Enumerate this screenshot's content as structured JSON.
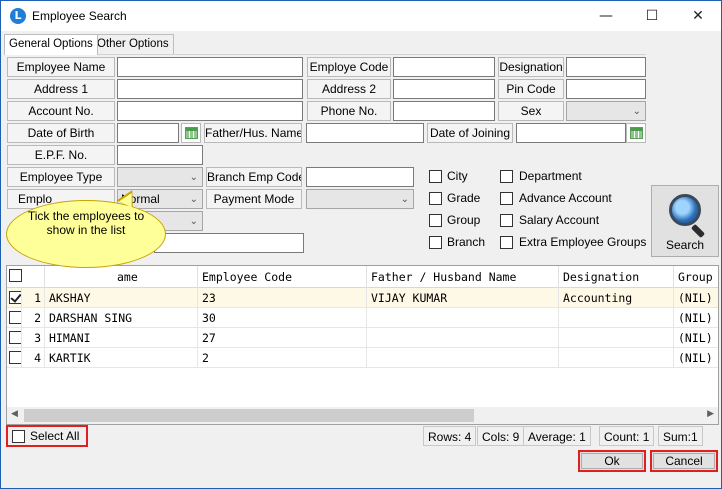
{
  "window": {
    "title": "Employee Search",
    "icon": "app-logo-icon"
  },
  "controls": {
    "minimize": "—",
    "maximize": "☐",
    "close": "✕"
  },
  "tabs": [
    {
      "label": "General Options"
    },
    {
      "label": "Other Options"
    }
  ],
  "form": {
    "employee_name": "Employee Name",
    "employe_code": "Employe Code",
    "designation": "Designation",
    "address1": "Address 1",
    "address2": "Address 2",
    "pin_code": "Pin Code",
    "account_no": "Account No.",
    "phone_no": "Phone No.",
    "sex": "Sex",
    "date_of_birth": "Date of Birth",
    "father_hus_name": "Father/Hus. Name",
    "date_of_joining": "Date of Joining",
    "epf_no": "E.P.F. No.",
    "employee_type": "Employee Type",
    "branch_emp_code": "Branch Emp Code",
    "emp_status_label_partial": "Emplo",
    "emp_status_value": "Normal",
    "payment_mode": "Payment Mode"
  },
  "checks": {
    "city": "City",
    "grade": "Grade",
    "group": "Group",
    "branch": "Branch",
    "department": "Department",
    "advance_account": "Advance Account",
    "salary_account": "Salary Account",
    "extra_employee_groups": "Extra Employee Groups"
  },
  "search_button": "Search",
  "callout": "Tick the employees to show in the list",
  "grid": {
    "columns": [
      "ame",
      "Employee Code",
      "Father / Husband Name",
      "Designation",
      "Group"
    ],
    "rows": [
      {
        "no": "1",
        "name": "AKSHAY",
        "code": "23",
        "father": "VIJAY KUMAR",
        "designation": "Accounting",
        "group": "(NIL)",
        "checked": true
      },
      {
        "no": "2",
        "name": "DARSHAN SING",
        "code": "30",
        "father": "",
        "designation": "",
        "group": "(NIL)",
        "checked": false
      },
      {
        "no": "3",
        "name": "HIMANI",
        "code": "27",
        "father": "",
        "designation": "",
        "group": "(NIL)",
        "checked": false
      },
      {
        "no": "4",
        "name": "KARTIK",
        "code": "2",
        "father": "",
        "designation": "",
        "group": "(NIL)",
        "checked": false
      }
    ]
  },
  "select_all": "Select All",
  "status": {
    "rows": "Rows: 4",
    "cols": "Cols: 9",
    "average": "Average: 1",
    "count": "Count: 1",
    "sum": "Sum:1"
  },
  "buttons": {
    "ok": "Ok",
    "cancel": "Cancel"
  },
  "colors": {
    "accent": "#1f7fd8",
    "highlight": "#e02020",
    "callout": "#ffff99"
  }
}
